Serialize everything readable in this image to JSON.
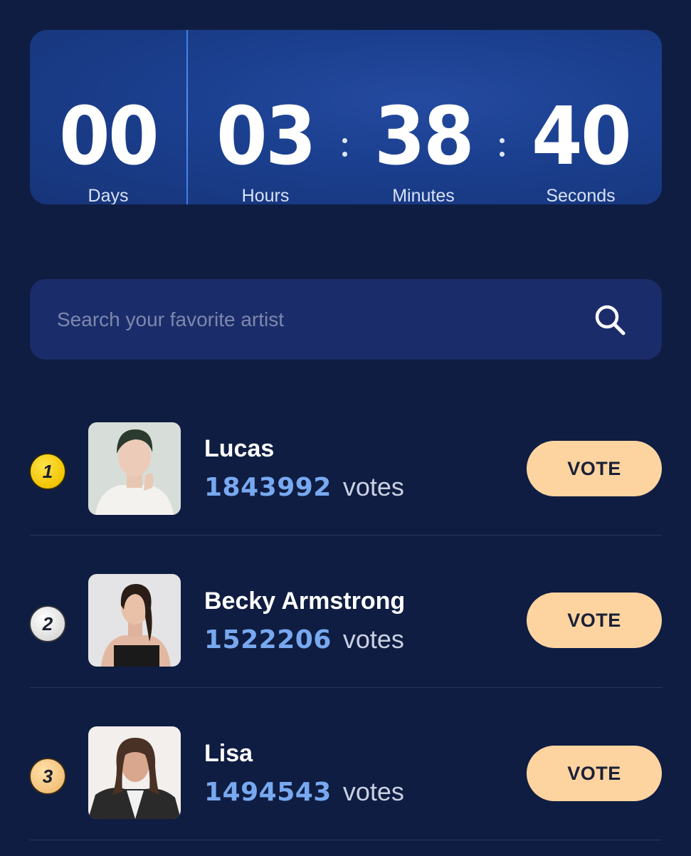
{
  "countdown": {
    "days": "00",
    "hours": "03",
    "minutes": "38",
    "seconds": "40",
    "days_label": "Days",
    "hours_label": "Hours",
    "minutes_label": "Minutes",
    "seconds_label": "Seconds"
  },
  "search": {
    "placeholder": "Search your favorite artist",
    "icon": "search-icon"
  },
  "artists": [
    {
      "rank": "1",
      "name": "Lucas",
      "votes": "1843992",
      "votes_label": "votes",
      "vote_button": "VOTE",
      "badge": "gold"
    },
    {
      "rank": "2",
      "name": "Becky Armstrong",
      "votes": "1522206",
      "votes_label": "votes",
      "vote_button": "VOTE",
      "badge": "silver"
    },
    {
      "rank": "3",
      "name": "Lisa",
      "votes": "1494543",
      "votes_label": "votes",
      "vote_button": "VOTE",
      "badge": "bronze"
    }
  ],
  "colors": {
    "background": "#0f1d42",
    "countdown_panel": "#1b3f8e",
    "search_bg": "#1b2c6a",
    "vote_count": "#78a9f0",
    "vote_button": "#fdd4a0",
    "rank_gold": "#f1c400",
    "rank_silver": "#dcdcdc",
    "rank_bronze": "#f3c27a"
  }
}
